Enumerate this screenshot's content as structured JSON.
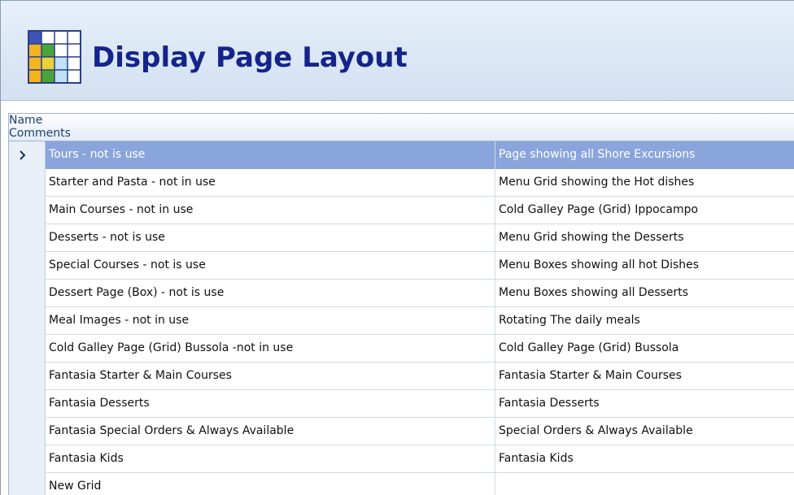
{
  "header": {
    "title": "Display Page Layout",
    "icon": "grid-layout-icon"
  },
  "grid": {
    "columns": [
      "Name",
      "Comments"
    ],
    "selected_index": 0,
    "rows": [
      {
        "name": "Tours - not is use",
        "comments": "Page showing all Shore Excursions"
      },
      {
        "name": "Starter and Pasta - not in use",
        "comments": "Menu Grid showing the Hot dishes"
      },
      {
        "name": "Main Courses - not in use",
        "comments": "Cold Galley Page (Grid) Ippocampo"
      },
      {
        "name": "Desserts - not is use",
        "comments": "Menu Grid showing the Desserts"
      },
      {
        "name": "Special Courses - not is use",
        "comments": "Menu Boxes showing all hot Dishes"
      },
      {
        "name": "Dessert Page (Box) - not is use",
        "comments": "Menu Boxes showing all Desserts"
      },
      {
        "name": "Meal Images - not in use",
        "comments": "Rotating The daily meals"
      },
      {
        "name": "Cold Galley Page (Grid) Bussola -not in use",
        "comments": "Cold Galley Page (Grid) Bussola"
      },
      {
        "name": "Fantasia Starter & Main Courses",
        "comments": "Fantasia Starter & Main Courses"
      },
      {
        "name": "Fantasia Desserts",
        "comments": "Fantasia Desserts"
      },
      {
        "name": "Fantasia Special Orders & Always Available",
        "comments": "Special Orders & Always Available"
      },
      {
        "name": "Fantasia Kids",
        "comments": "Fantasia Kids"
      },
      {
        "name": "New Grid",
        "comments": ""
      }
    ]
  },
  "colors": {
    "title": "#15248a",
    "selection": "#8aa5dc",
    "header_bg": "#dbe7f5"
  }
}
